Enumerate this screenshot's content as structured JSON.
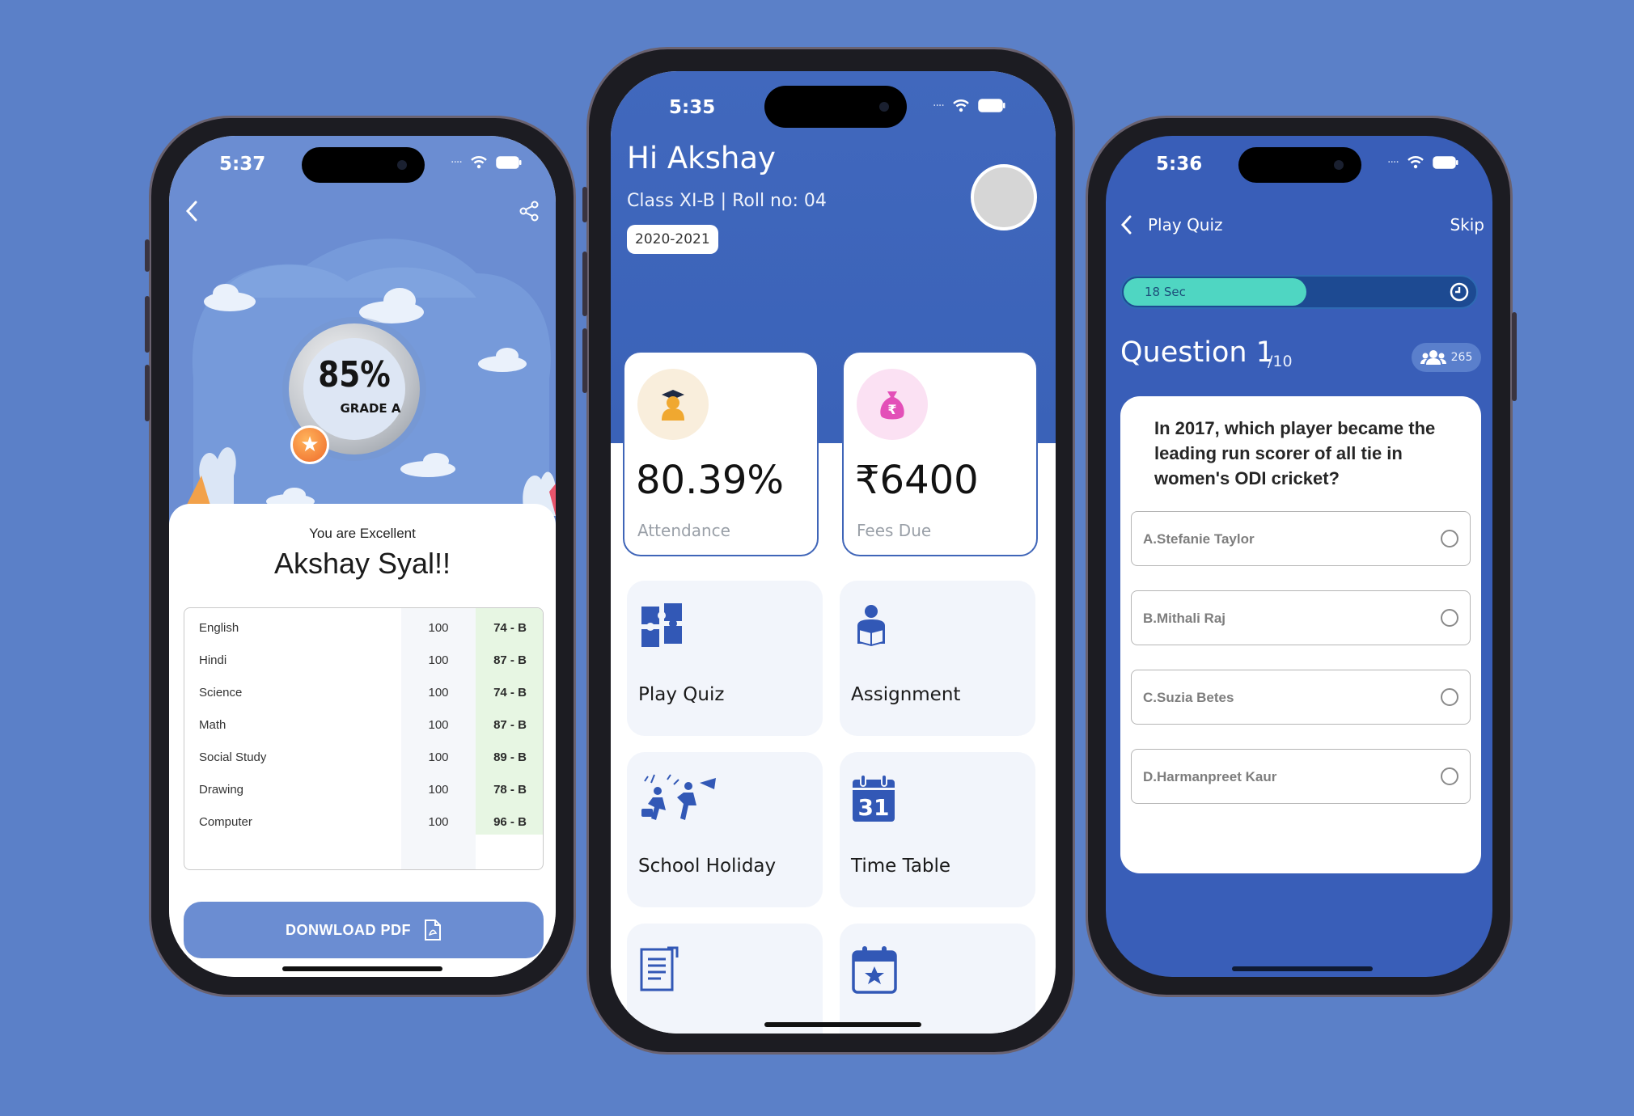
{
  "result_screen": {
    "status_time": "5:37",
    "score_percent": "85%",
    "grade": "GRADE A",
    "subtitle": "You are Excellent",
    "student_name": "Akshay Syal!!",
    "marks": [
      {
        "subject": "English",
        "max": "100",
        "grade": "74 - B"
      },
      {
        "subject": "Hindi",
        "max": "100",
        "grade": "87 - B"
      },
      {
        "subject": "Science",
        "max": "100",
        "grade": "74 - B"
      },
      {
        "subject": "Math",
        "max": "100",
        "grade": "87 - B"
      },
      {
        "subject": "Social Study",
        "max": "100",
        "grade": "89 - B"
      },
      {
        "subject": "Drawing",
        "max": "100",
        "grade": "78 - B"
      },
      {
        "subject": "Computer",
        "max": "100",
        "grade": "96 - B"
      }
    ],
    "download_label": "DONWLOAD PDF"
  },
  "dashboard_screen": {
    "status_time": "5:35",
    "greeting": "Hi Akshay",
    "class_info": "Class XI-B | Roll no: 04",
    "academic_year": "2020-2021",
    "stats": [
      {
        "value": "80.39%",
        "label": "Attendance",
        "icon": "graduate-icon",
        "color": "#f9eedc"
      },
      {
        "value": "₹6400",
        "label": "Fees Due",
        "icon": "money-bag-icon",
        "color": "#fbe1f3"
      }
    ],
    "tiles": [
      {
        "label": "Play Quiz",
        "icon": "puzzle-icon"
      },
      {
        "label": "Assignment",
        "icon": "reading-icon"
      },
      {
        "label": "School Holiday",
        "icon": "holiday-icon"
      },
      {
        "label": "Time Table",
        "icon": "calendar-31-icon"
      },
      {
        "label": "",
        "icon": "document-icon"
      },
      {
        "label": "",
        "icon": "calendar-star-icon"
      }
    ],
    "colors": {
      "header": "#3f65b8",
      "accent": "#3258b6",
      "tile_bg": "#f2f5fb"
    }
  },
  "quiz_screen": {
    "status_time": "5:36",
    "title": "Play Quiz",
    "skip_label": "Skip",
    "timer_label": "18 Sec",
    "timer_progress": 0.52,
    "question_number": "Question 1",
    "question_total": "/10",
    "participants": "265",
    "question": "In 2017, which player became the leading run scorer of all tie in women's ODI cricket?",
    "options": [
      "A.Stefanie Taylor",
      "B.Mithali Raj",
      "C.Suzia Betes",
      "D.Harmanpreet Kaur"
    ],
    "colors": {
      "background": "#395eb8",
      "timer_fill": "#4fd6c2"
    }
  }
}
